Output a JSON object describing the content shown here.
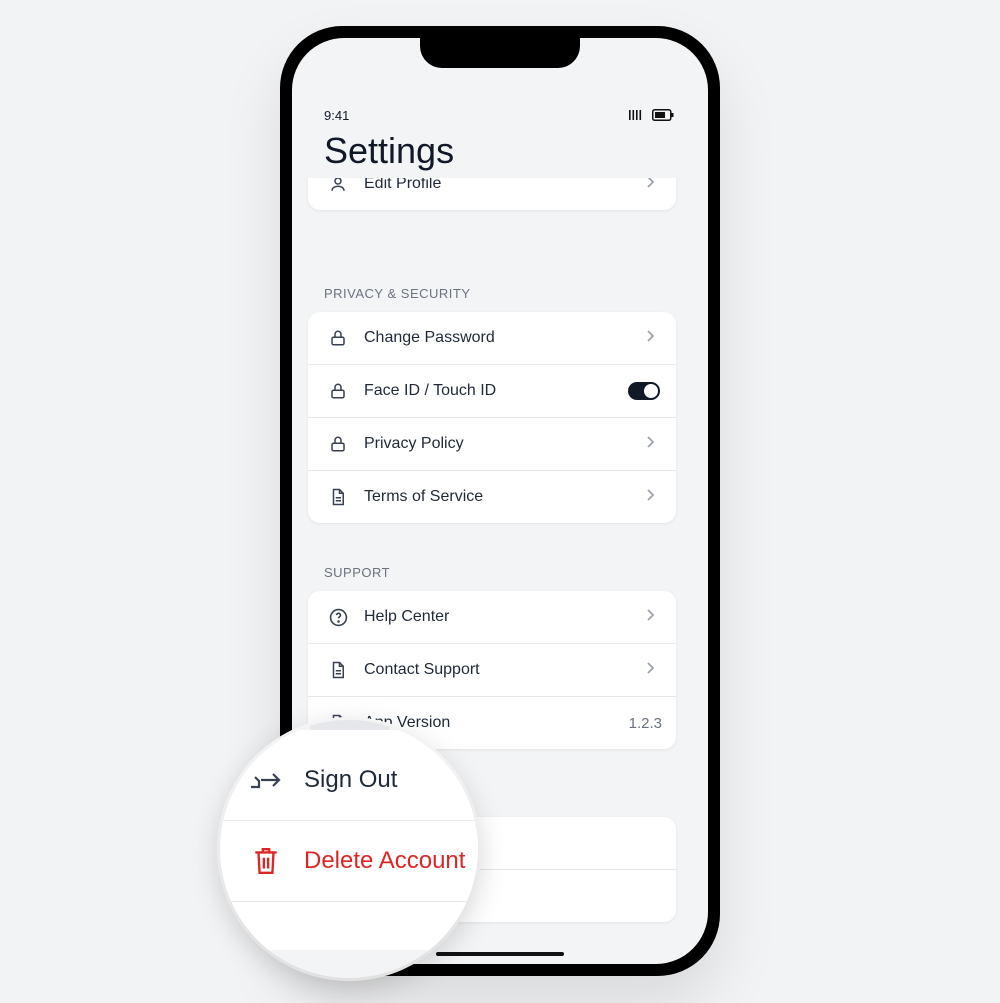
{
  "status": {
    "time": "9:41"
  },
  "header": {
    "title": "Settings"
  },
  "account": {
    "edit_profile": "Edit Profile"
  },
  "privacy": {
    "section_title": "PRIVACY & SECURITY",
    "items": [
      {
        "label": "Change Password",
        "icon": "lock-icon",
        "trailing": "chevron"
      },
      {
        "label": "Face ID / Touch ID",
        "icon": "lock-icon",
        "trailing": "toggle",
        "enabled": true
      },
      {
        "label": "Privacy Policy",
        "icon": "lock-icon",
        "trailing": "chevron"
      },
      {
        "label": "Terms of Service",
        "icon": "document-icon",
        "trailing": "chevron"
      }
    ]
  },
  "support": {
    "section_title": "SUPPORT",
    "items": [
      {
        "label": "Help Center",
        "icon": "help-circle-icon",
        "trailing": "chevron"
      },
      {
        "label": "Contact Support",
        "icon": "document-icon",
        "trailing": "chevron"
      },
      {
        "label": "App Version",
        "icon": "document-icon",
        "value": "1.2.3"
      }
    ]
  },
  "actions": {
    "sign_out": "Sign Out",
    "delete_account": "Delete Account",
    "danger_color": "#dc2626"
  }
}
